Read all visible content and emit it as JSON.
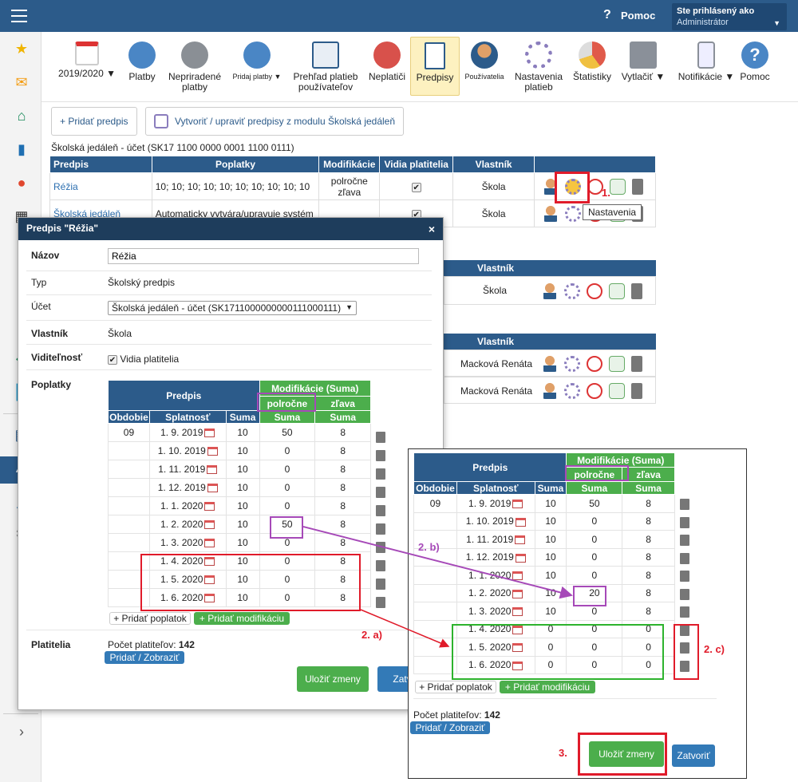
{
  "header": {
    "help_label": "Pomoc",
    "user_caption": "Ste prihlásený ako",
    "user_name": "Administrátor"
  },
  "toolbar": {
    "items": [
      {
        "label": "2019/2020 ▼"
      },
      {
        "label": "Platby"
      },
      {
        "label": "Nepriradené platby"
      },
      {
        "label": "Pridaj platby ▼"
      },
      {
        "label": "Prehľad platieb používateľov"
      },
      {
        "label": "Neplatiči"
      },
      {
        "label": "Predpisy"
      },
      {
        "label": "Používatelia"
      },
      {
        "label": "Nastavenia platieb"
      },
      {
        "label": "Štatistiky"
      },
      {
        "label": "Vytlačiť ▼"
      },
      {
        "label": "Notifikácie ▼"
      },
      {
        "label": "Pomoc"
      }
    ]
  },
  "actions": {
    "add_predpis": "+ Pridať predpis",
    "create_from_module": "Vytvoriť / upraviť predpisy z modulu Školská jedáleň"
  },
  "account_title": "Školská jedáleň - účet (SK17 1100 0000 0001 1100 0111)",
  "bg_table": {
    "headers": [
      "Predpis",
      "Poplatky",
      "Modifikácie",
      "Vidia platitelia",
      "Vlastník"
    ],
    "rows": [
      {
        "predpis": "Réžia",
        "poplatky": "10; 10; 10; 10; 10; 10; 10; 10; 10; 10",
        "modifikacie": "polročne zľava",
        "vlastnik": "Škola"
      },
      {
        "predpis": "Školská jedáleň",
        "poplatky": "Automaticky vytvára/upravuje systém",
        "modifikacie": "",
        "vlastnik": "Škola"
      }
    ],
    "header2": "Vlastník",
    "row3_owner": "Škola",
    "header3": "Vlastník",
    "row4_owner": "Macková Renáta",
    "row5_owner": "Macková Renáta"
  },
  "tooltip": "Nastavenia",
  "dialog": {
    "title": "Predpis \"Réžia\"",
    "close": "×",
    "name_label": "Názov",
    "name_value": "Réžia",
    "type_label": "Typ",
    "type_value": "Školský predpis",
    "account_label": "Účet",
    "account_value": "Školská jedáleň - účet (SK1711000000000111000111)",
    "owner_label": "Vlastník",
    "owner_value": "Škola",
    "visibility_label": "Viditeľnosť",
    "visibility_value": "Vidia platitelia",
    "fees_label": "Poplatky",
    "payers_label": "Platitelia",
    "payers_count_label": "Počet platiteľov:",
    "payers_count": "142",
    "add_show": "Pridať / Zobraziť",
    "save": "Uložiť zmeny",
    "close_btn": "Zatvoriť",
    "add_fee": "+ Pridať poplatok",
    "add_mod": "+ Pridať modifikáciu"
  },
  "fee_table": {
    "h_predpis": "Predpis",
    "h_mods": "Modifikácie (Suma)",
    "h_polrocne": "polročne",
    "h_zlava": "zľava",
    "h_obdobie": "Obdobie",
    "h_splatnost": "Splatnosť",
    "h_suma": "Suma",
    "rows": [
      {
        "obdobie": "09",
        "date": "1. 9. 2019",
        "suma": "10",
        "p": "50",
        "z": "8"
      },
      {
        "obdobie": "",
        "date": "1. 10. 2019",
        "suma": "10",
        "p": "0",
        "z": "8"
      },
      {
        "obdobie": "",
        "date": "1. 11. 2019",
        "suma": "10",
        "p": "0",
        "z": "8"
      },
      {
        "obdobie": "",
        "date": "1. 12. 2019",
        "suma": "10",
        "p": "0",
        "z": "8"
      },
      {
        "obdobie": "",
        "date": "1. 1. 2020",
        "suma": "10",
        "p": "0",
        "z": "8"
      },
      {
        "obdobie": "",
        "date": "1. 2. 2020",
        "suma": "10",
        "p": "50",
        "z": "8"
      },
      {
        "obdobie": "",
        "date": "1. 3. 2020",
        "suma": "10",
        "p": "0",
        "z": "8"
      },
      {
        "obdobie": "",
        "date": "1. 4. 2020",
        "suma": "10",
        "p": "0",
        "z": "8"
      },
      {
        "obdobie": "",
        "date": "1. 5. 2020",
        "suma": "10",
        "p": "0",
        "z": "8"
      },
      {
        "obdobie": "",
        "date": "1. 6. 2020",
        "suma": "10",
        "p": "0",
        "z": "8"
      }
    ]
  },
  "zoom_table": {
    "rows": [
      {
        "obdobie": "09",
        "date": "1. 9. 2019",
        "suma": "10",
        "p": "50",
        "z": "8"
      },
      {
        "obdobie": "",
        "date": "1. 10. 2019",
        "suma": "10",
        "p": "0",
        "z": "8"
      },
      {
        "obdobie": "",
        "date": "1. 11. 2019",
        "suma": "10",
        "p": "0",
        "z": "8"
      },
      {
        "obdobie": "",
        "date": "1. 12. 2019",
        "suma": "10",
        "p": "0",
        "z": "8"
      },
      {
        "obdobie": "",
        "date": "1. 1. 2020",
        "suma": "10",
        "p": "0",
        "z": "8"
      },
      {
        "obdobie": "",
        "date": "1. 2. 2020",
        "suma": "10",
        "p": "20",
        "z": "8"
      },
      {
        "obdobie": "",
        "date": "1. 3. 2020",
        "suma": "10",
        "p": "0",
        "z": "8"
      },
      {
        "obdobie": "",
        "date": "1. 4. 2020",
        "suma": "0",
        "p": "0",
        "z": "0"
      },
      {
        "obdobie": "",
        "date": "1. 5. 2020",
        "suma": "0",
        "p": "0",
        "z": "0"
      },
      {
        "obdobie": "",
        "date": "1. 6. 2020",
        "suma": "0",
        "p": "0",
        "z": "0"
      }
    ]
  },
  "annotations": {
    "a1": "1.",
    "a2a": "2. a)",
    "a2b": "2. b)",
    "a2c": "2. c)",
    "a3": "3."
  },
  "colors": {
    "primary": "#2c5b8a",
    "green": "#4cae4c",
    "annotation_red": "#e01b2a",
    "annotation_purple": "#a649b8",
    "annotation_green": "#2db32d"
  }
}
